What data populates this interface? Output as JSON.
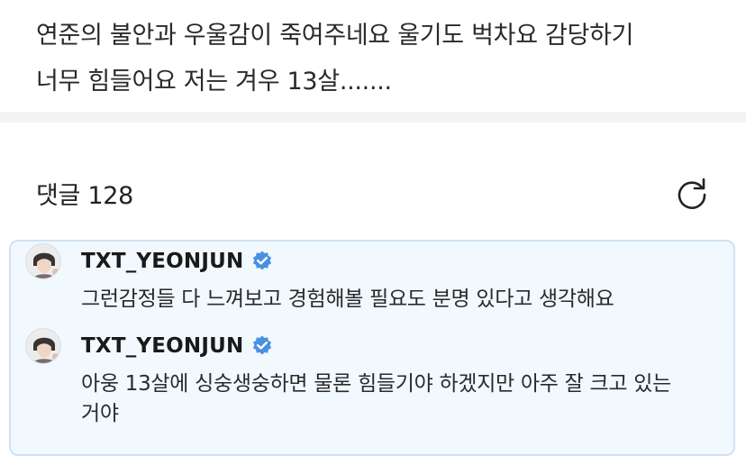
{
  "post": {
    "body_lines": [
      "연준의 불안과 우울감이 죽여주네요 울기도 벅차요 감당하기",
      "너무 힘들어요 저는 겨우 13살......."
    ]
  },
  "comments": {
    "count_label": "댓글 128",
    "refresh_icon": "refresh-icon"
  },
  "thread": {
    "accent_border": "#cfe3f5",
    "accent_bg": "#f1f8fe",
    "verified_color": "#4a90e2",
    "items": [
      {
        "author": "TXT_YEONJUN",
        "verified": true,
        "text_lines": [
          "그런감정들 다 느껴보고 경험해볼 필요도 분명 있다고 생각해요"
        ]
      },
      {
        "author": "TXT_YEONJUN",
        "verified": true,
        "text_lines": [
          "아웅 13살에 싱숭생숭하면 물론 힘들기야 하겠지만 아주 잘 크고 있는",
          "거야"
        ]
      }
    ]
  }
}
